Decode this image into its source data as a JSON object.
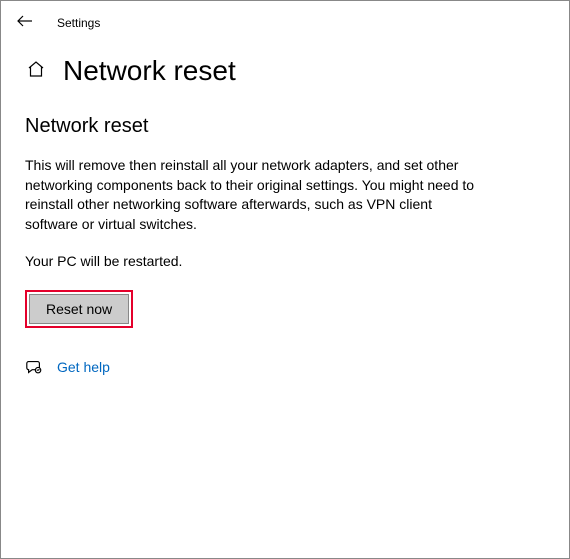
{
  "titlebar": {
    "app_title": "Settings"
  },
  "header": {
    "page_title": "Network reset"
  },
  "content": {
    "section_title": "Network reset",
    "description": "This will remove then reinstall all your network adapters, and set other networking components back to their original settings. You might need to reinstall other networking software afterwards, such as VPN client software or virtual switches.",
    "restart_note": "Your PC will be restarted.",
    "reset_button": "Reset now",
    "help_link": "Get help"
  }
}
